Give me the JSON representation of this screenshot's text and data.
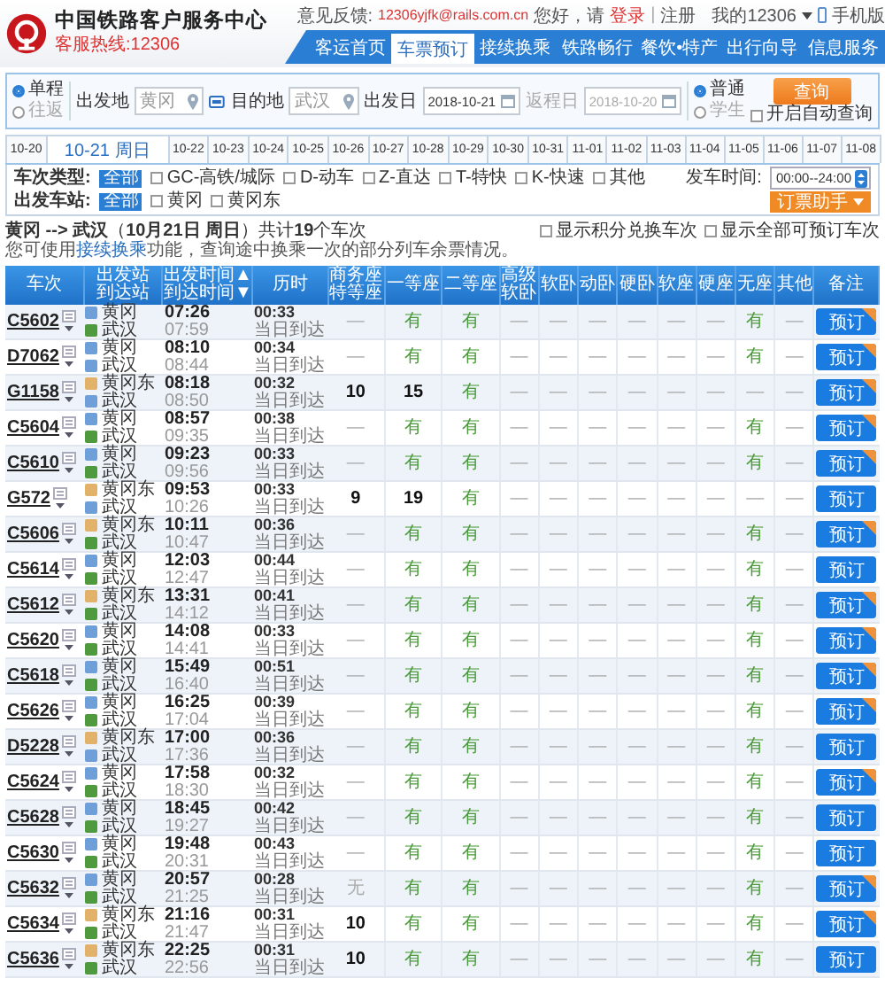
{
  "header": {
    "title": "中国铁路客户服务中心",
    "hotline": "客服热线:12306",
    "feedback_label": "意见反馈:",
    "feedback_email": "12306yjfk@rails.com.cn",
    "greeting": "您好，请",
    "login": "登录",
    "separator": "|",
    "register": "注册",
    "my_account": "我的12306",
    "mobile": "手机版"
  },
  "nav": [
    {
      "label": "客运首页",
      "selected": false
    },
    {
      "label": "车票预订",
      "selected": true
    },
    {
      "label": "接续换乘",
      "selected": false
    },
    {
      "label": "铁路畅行",
      "selected": false
    },
    {
      "label": "餐饮•特产",
      "selected": false
    },
    {
      "label": "出行向导",
      "selected": false
    },
    {
      "label": "信息服务",
      "selected": false
    }
  ],
  "search": {
    "trip_types": [
      {
        "label": "单程",
        "selected": true
      },
      {
        "label": "往返",
        "selected": false
      }
    ],
    "from": {
      "label": "出发地",
      "placeholder": "黄冈"
    },
    "to": {
      "label": "目的地",
      "placeholder": "武汉"
    },
    "depart": {
      "label": "出发日",
      "value": "2018-10-21",
      "disabled": false
    },
    "return": {
      "label": "返程日",
      "value": "2018-10-20",
      "disabled": true
    },
    "passenger_types": [
      {
        "label": "普通",
        "selected": true
      },
      {
        "label": "学生",
        "selected": false
      }
    ],
    "query_button": "查询",
    "auto_query": {
      "label": "开启自动查询",
      "checked": false
    }
  },
  "date_tabs": [
    {
      "label": "10-20",
      "selected": false
    },
    {
      "label": "10-21 周日",
      "selected": true
    },
    {
      "label": "10-22",
      "selected": false
    },
    {
      "label": "10-23",
      "selected": false
    },
    {
      "label": "10-24",
      "selected": false
    },
    {
      "label": "10-25",
      "selected": false
    },
    {
      "label": "10-26",
      "selected": false
    },
    {
      "label": "10-27",
      "selected": false
    },
    {
      "label": "10-28",
      "selected": false
    },
    {
      "label": "10-29",
      "selected": false
    },
    {
      "label": "10-30",
      "selected": false
    },
    {
      "label": "10-31",
      "selected": false
    },
    {
      "label": "11-01",
      "selected": false
    },
    {
      "label": "11-02",
      "selected": false
    },
    {
      "label": "11-03",
      "selected": false
    },
    {
      "label": "11-04",
      "selected": false
    },
    {
      "label": "11-05",
      "selected": false
    },
    {
      "label": "11-06",
      "selected": false
    },
    {
      "label": "11-07",
      "selected": false
    },
    {
      "label": "11-08",
      "selected": false
    }
  ],
  "filters": {
    "type_label": "车次类型:",
    "type_all": "全部",
    "types": [
      {
        "label": "GC-高铁/城际",
        "checked": false
      },
      {
        "label": "D-动车",
        "checked": false
      },
      {
        "label": "Z-直达",
        "checked": false
      },
      {
        "label": "T-特快",
        "checked": false
      },
      {
        "label": "K-快速",
        "checked": false
      },
      {
        "label": "其他",
        "checked": false
      }
    ],
    "time_label": "发车时间:",
    "time_value": "00:00--24:00",
    "station_label": "出发车站:",
    "station_all": "全部",
    "stations": [
      {
        "label": "黄冈",
        "checked": false
      },
      {
        "label": "黄冈东",
        "checked": false
      }
    ],
    "helper_button": "订票助手"
  },
  "summary": {
    "text": "**黄冈 --> 武汉**（**10月21日  周日**）共计**19**个车次",
    "options": [
      {
        "label": "显示积分兑换车次",
        "checked": false
      },
      {
        "label": "显示全部可预订车次",
        "checked": false
      }
    ],
    "hint_before": "您可使用",
    "hint_link": "接续换乘",
    "hint_after": "功能，查询途中换乘一次的部分列车余票情况。"
  },
  "table": {
    "columns": [
      {
        "lines": [
          "车次"
        ]
      },
      {
        "lines": [
          "出发站",
          "到达站"
        ]
      },
      {
        "lines": [
          "出发时间▲",
          "到达时间▼"
        ]
      },
      {
        "lines": [
          "历时"
        ]
      },
      {
        "lines": [
          "商务座",
          "特等座"
        ]
      },
      {
        "lines": [
          "一等座"
        ]
      },
      {
        "lines": [
          "二等座"
        ]
      },
      {
        "lines": [
          "高级",
          "软卧"
        ]
      },
      {
        "lines": [
          "软卧"
        ]
      },
      {
        "lines": [
          "动卧"
        ]
      },
      {
        "lines": [
          "硬卧"
        ]
      },
      {
        "lines": [
          "软座"
        ]
      },
      {
        "lines": [
          "硬座"
        ]
      },
      {
        "lines": [
          "无座"
        ]
      },
      {
        "lines": [
          "其他"
        ]
      },
      {
        "lines": [
          "备注"
        ]
      }
    ],
    "rows": [
      {
        "train": "C5602",
        "from": {
          "name": "黄冈",
          "color": "#6f9fd8"
        },
        "to": {
          "name": "武汉",
          "color": "#4f9a3f"
        },
        "depart": "07:26",
        "arrive": "07:59",
        "duration": "00:33",
        "arrival_day": "当日到达",
        "seats": [
          {
            "text": "—",
            "kind": "none"
          },
          {
            "text": "有",
            "kind": "available"
          },
          {
            "text": "有",
            "kind": "available"
          },
          {
            "text": "—",
            "kind": "none"
          },
          {
            "text": "—",
            "kind": "none"
          },
          {
            "text": "—",
            "kind": "none"
          },
          {
            "text": "—",
            "kind": "none"
          },
          {
            "text": "—",
            "kind": "none"
          },
          {
            "text": "—",
            "kind": "none"
          },
          {
            "text": "有",
            "kind": "available"
          },
          {
            "text": "—",
            "kind": "none"
          }
        ],
        "button": "预订",
        "promo": true
      },
      {
        "train": "D7062",
        "from": {
          "name": "黄冈",
          "color": "#6f9fd8"
        },
        "to": {
          "name": "武汉",
          "color": "#6f9fd8"
        },
        "depart": "08:10",
        "arrive": "08:44",
        "duration": "00:34",
        "arrival_day": "当日到达",
        "seats": [
          {
            "text": "—",
            "kind": "none"
          },
          {
            "text": "有",
            "kind": "available"
          },
          {
            "text": "有",
            "kind": "available"
          },
          {
            "text": "—",
            "kind": "none"
          },
          {
            "text": "—",
            "kind": "none"
          },
          {
            "text": "—",
            "kind": "none"
          },
          {
            "text": "—",
            "kind": "none"
          },
          {
            "text": "—",
            "kind": "none"
          },
          {
            "text": "—",
            "kind": "none"
          },
          {
            "text": "有",
            "kind": "available"
          },
          {
            "text": "—",
            "kind": "none"
          }
        ],
        "button": "预订",
        "promo": true
      },
      {
        "train": "G1158",
        "from": {
          "name": "黄冈东",
          "color": "#e3b26a"
        },
        "to": {
          "name": "武汉",
          "color": "#6f9fd8"
        },
        "depart": "08:18",
        "arrive": "08:50",
        "duration": "00:32",
        "arrival_day": "当日到达",
        "seats": [
          {
            "text": "10",
            "kind": "count"
          },
          {
            "text": "15",
            "kind": "count"
          },
          {
            "text": "有",
            "kind": "available"
          },
          {
            "text": "—",
            "kind": "none"
          },
          {
            "text": "—",
            "kind": "none"
          },
          {
            "text": "—",
            "kind": "none"
          },
          {
            "text": "—",
            "kind": "none"
          },
          {
            "text": "—",
            "kind": "none"
          },
          {
            "text": "—",
            "kind": "none"
          },
          {
            "text": "—",
            "kind": "none"
          },
          {
            "text": "—",
            "kind": "none"
          }
        ],
        "button": "预订",
        "promo": true
      },
      {
        "train": "C5604",
        "from": {
          "name": "黄冈",
          "color": "#6f9fd8"
        },
        "to": {
          "name": "武汉",
          "color": "#4f9a3f"
        },
        "depart": "08:57",
        "arrive": "09:35",
        "duration": "00:38",
        "arrival_day": "当日到达",
        "seats": [
          {
            "text": "—",
            "kind": "none"
          },
          {
            "text": "有",
            "kind": "available"
          },
          {
            "text": "有",
            "kind": "available"
          },
          {
            "text": "—",
            "kind": "none"
          },
          {
            "text": "—",
            "kind": "none"
          },
          {
            "text": "—",
            "kind": "none"
          },
          {
            "text": "—",
            "kind": "none"
          },
          {
            "text": "—",
            "kind": "none"
          },
          {
            "text": "—",
            "kind": "none"
          },
          {
            "text": "有",
            "kind": "available"
          },
          {
            "text": "—",
            "kind": "none"
          }
        ],
        "button": "预订",
        "promo": true
      },
      {
        "train": "C5610",
        "from": {
          "name": "黄冈",
          "color": "#6f9fd8"
        },
        "to": {
          "name": "武汉",
          "color": "#4f9a3f"
        },
        "depart": "09:23",
        "arrive": "09:56",
        "duration": "00:33",
        "arrival_day": "当日到达",
        "seats": [
          {
            "text": "—",
            "kind": "none"
          },
          {
            "text": "有",
            "kind": "available"
          },
          {
            "text": "有",
            "kind": "available"
          },
          {
            "text": "—",
            "kind": "none"
          },
          {
            "text": "—",
            "kind": "none"
          },
          {
            "text": "—",
            "kind": "none"
          },
          {
            "text": "—",
            "kind": "none"
          },
          {
            "text": "—",
            "kind": "none"
          },
          {
            "text": "—",
            "kind": "none"
          },
          {
            "text": "有",
            "kind": "available"
          },
          {
            "text": "—",
            "kind": "none"
          }
        ],
        "button": "预订",
        "promo": true
      },
      {
        "train": "G572",
        "from": {
          "name": "黄冈东",
          "color": "#e3b26a"
        },
        "to": {
          "name": "武汉",
          "color": "#6f9fd8"
        },
        "depart": "09:53",
        "arrive": "10:26",
        "duration": "00:33",
        "arrival_day": "当日到达",
        "seats": [
          {
            "text": "9",
            "kind": "count"
          },
          {
            "text": "19",
            "kind": "count"
          },
          {
            "text": "有",
            "kind": "available"
          },
          {
            "text": "—",
            "kind": "none"
          },
          {
            "text": "—",
            "kind": "none"
          },
          {
            "text": "—",
            "kind": "none"
          },
          {
            "text": "—",
            "kind": "none"
          },
          {
            "text": "—",
            "kind": "none"
          },
          {
            "text": "—",
            "kind": "none"
          },
          {
            "text": "—",
            "kind": "none"
          },
          {
            "text": "—",
            "kind": "none"
          }
        ],
        "button": "预订",
        "promo": false
      },
      {
        "train": "C5606",
        "from": {
          "name": "黄冈东",
          "color": "#e3b26a"
        },
        "to": {
          "name": "武汉",
          "color": "#4f9a3f"
        },
        "depart": "10:11",
        "arrive": "10:47",
        "duration": "00:36",
        "arrival_day": "当日到达",
        "seats": [
          {
            "text": "—",
            "kind": "none"
          },
          {
            "text": "有",
            "kind": "available"
          },
          {
            "text": "有",
            "kind": "available"
          },
          {
            "text": "—",
            "kind": "none"
          },
          {
            "text": "—",
            "kind": "none"
          },
          {
            "text": "—",
            "kind": "none"
          },
          {
            "text": "—",
            "kind": "none"
          },
          {
            "text": "—",
            "kind": "none"
          },
          {
            "text": "—",
            "kind": "none"
          },
          {
            "text": "有",
            "kind": "available"
          },
          {
            "text": "—",
            "kind": "none"
          }
        ],
        "button": "预订",
        "promo": true
      },
      {
        "train": "C5614",
        "from": {
          "name": "黄冈",
          "color": "#6f9fd8"
        },
        "to": {
          "name": "武汉",
          "color": "#4f9a3f"
        },
        "depart": "12:03",
        "arrive": "12:47",
        "duration": "00:44",
        "arrival_day": "当日到达",
        "seats": [
          {
            "text": "—",
            "kind": "none"
          },
          {
            "text": "有",
            "kind": "available"
          },
          {
            "text": "有",
            "kind": "available"
          },
          {
            "text": "—",
            "kind": "none"
          },
          {
            "text": "—",
            "kind": "none"
          },
          {
            "text": "—",
            "kind": "none"
          },
          {
            "text": "—",
            "kind": "none"
          },
          {
            "text": "—",
            "kind": "none"
          },
          {
            "text": "—",
            "kind": "none"
          },
          {
            "text": "有",
            "kind": "available"
          },
          {
            "text": "—",
            "kind": "none"
          }
        ],
        "button": "预订",
        "promo": false
      },
      {
        "train": "C5612",
        "from": {
          "name": "黄冈东",
          "color": "#e3b26a"
        },
        "to": {
          "name": "武汉",
          "color": "#4f9a3f"
        },
        "depart": "13:31",
        "arrive": "14:12",
        "duration": "00:41",
        "arrival_day": "当日到达",
        "seats": [
          {
            "text": "—",
            "kind": "none"
          },
          {
            "text": "有",
            "kind": "available"
          },
          {
            "text": "有",
            "kind": "available"
          },
          {
            "text": "—",
            "kind": "none"
          },
          {
            "text": "—",
            "kind": "none"
          },
          {
            "text": "—",
            "kind": "none"
          },
          {
            "text": "—",
            "kind": "none"
          },
          {
            "text": "—",
            "kind": "none"
          },
          {
            "text": "—",
            "kind": "none"
          },
          {
            "text": "有",
            "kind": "available"
          },
          {
            "text": "—",
            "kind": "none"
          }
        ],
        "button": "预订",
        "promo": true
      },
      {
        "train": "C5620",
        "from": {
          "name": "黄冈",
          "color": "#6f9fd8"
        },
        "to": {
          "name": "武汉",
          "color": "#4f9a3f"
        },
        "depart": "14:08",
        "arrive": "14:41",
        "duration": "00:33",
        "arrival_day": "当日到达",
        "seats": [
          {
            "text": "—",
            "kind": "none"
          },
          {
            "text": "有",
            "kind": "available"
          },
          {
            "text": "有",
            "kind": "available"
          },
          {
            "text": "—",
            "kind": "none"
          },
          {
            "text": "—",
            "kind": "none"
          },
          {
            "text": "—",
            "kind": "none"
          },
          {
            "text": "—",
            "kind": "none"
          },
          {
            "text": "—",
            "kind": "none"
          },
          {
            "text": "—",
            "kind": "none"
          },
          {
            "text": "有",
            "kind": "available"
          },
          {
            "text": "—",
            "kind": "none"
          }
        ],
        "button": "预订",
        "promo": true
      },
      {
        "train": "C5618",
        "from": {
          "name": "黄冈",
          "color": "#6f9fd8"
        },
        "to": {
          "name": "武汉",
          "color": "#4f9a3f"
        },
        "depart": "15:49",
        "arrive": "16:40",
        "duration": "00:51",
        "arrival_day": "当日到达",
        "seats": [
          {
            "text": "—",
            "kind": "none"
          },
          {
            "text": "有",
            "kind": "available"
          },
          {
            "text": "有",
            "kind": "available"
          },
          {
            "text": "—",
            "kind": "none"
          },
          {
            "text": "—",
            "kind": "none"
          },
          {
            "text": "—",
            "kind": "none"
          },
          {
            "text": "—",
            "kind": "none"
          },
          {
            "text": "—",
            "kind": "none"
          },
          {
            "text": "—",
            "kind": "none"
          },
          {
            "text": "有",
            "kind": "available"
          },
          {
            "text": "—",
            "kind": "none"
          }
        ],
        "button": "预订",
        "promo": true
      },
      {
        "train": "C5626",
        "from": {
          "name": "黄冈",
          "color": "#6f9fd8"
        },
        "to": {
          "name": "武汉",
          "color": "#4f9a3f"
        },
        "depart": "16:25",
        "arrive": "17:04",
        "duration": "00:39",
        "arrival_day": "当日到达",
        "seats": [
          {
            "text": "—",
            "kind": "none"
          },
          {
            "text": "有",
            "kind": "available"
          },
          {
            "text": "有",
            "kind": "available"
          },
          {
            "text": "—",
            "kind": "none"
          },
          {
            "text": "—",
            "kind": "none"
          },
          {
            "text": "—",
            "kind": "none"
          },
          {
            "text": "—",
            "kind": "none"
          },
          {
            "text": "—",
            "kind": "none"
          },
          {
            "text": "—",
            "kind": "none"
          },
          {
            "text": "有",
            "kind": "available"
          },
          {
            "text": "—",
            "kind": "none"
          }
        ],
        "button": "预订",
        "promo": true
      },
      {
        "train": "D5228",
        "from": {
          "name": "黄冈东",
          "color": "#e3b26a"
        },
        "to": {
          "name": "武汉",
          "color": "#6f9fd8"
        },
        "depart": "17:00",
        "arrive": "17:36",
        "duration": "00:36",
        "arrival_day": "当日到达",
        "seats": [
          {
            "text": "—",
            "kind": "none"
          },
          {
            "text": "有",
            "kind": "available"
          },
          {
            "text": "有",
            "kind": "available"
          },
          {
            "text": "—",
            "kind": "none"
          },
          {
            "text": "—",
            "kind": "none"
          },
          {
            "text": "—",
            "kind": "none"
          },
          {
            "text": "—",
            "kind": "none"
          },
          {
            "text": "—",
            "kind": "none"
          },
          {
            "text": "—",
            "kind": "none"
          },
          {
            "text": "有",
            "kind": "available"
          },
          {
            "text": "—",
            "kind": "none"
          }
        ],
        "button": "预订",
        "promo": false
      },
      {
        "train": "C5624",
        "from": {
          "name": "黄冈",
          "color": "#6f9fd8"
        },
        "to": {
          "name": "武汉",
          "color": "#4f9a3f"
        },
        "depart": "17:58",
        "arrive": "18:30",
        "duration": "00:32",
        "arrival_day": "当日到达",
        "seats": [
          {
            "text": "—",
            "kind": "none"
          },
          {
            "text": "有",
            "kind": "available"
          },
          {
            "text": "有",
            "kind": "available"
          },
          {
            "text": "—",
            "kind": "none"
          },
          {
            "text": "—",
            "kind": "none"
          },
          {
            "text": "—",
            "kind": "none"
          },
          {
            "text": "—",
            "kind": "none"
          },
          {
            "text": "—",
            "kind": "none"
          },
          {
            "text": "—",
            "kind": "none"
          },
          {
            "text": "有",
            "kind": "available"
          },
          {
            "text": "—",
            "kind": "none"
          }
        ],
        "button": "预订",
        "promo": true
      },
      {
        "train": "C5628",
        "from": {
          "name": "黄冈",
          "color": "#6f9fd8"
        },
        "to": {
          "name": "武汉",
          "color": "#4f9a3f"
        },
        "depart": "18:45",
        "arrive": "19:27",
        "duration": "00:42",
        "arrival_day": "当日到达",
        "seats": [
          {
            "text": "—",
            "kind": "none"
          },
          {
            "text": "有",
            "kind": "available"
          },
          {
            "text": "有",
            "kind": "available"
          },
          {
            "text": "—",
            "kind": "none"
          },
          {
            "text": "—",
            "kind": "none"
          },
          {
            "text": "—",
            "kind": "none"
          },
          {
            "text": "—",
            "kind": "none"
          },
          {
            "text": "—",
            "kind": "none"
          },
          {
            "text": "—",
            "kind": "none"
          },
          {
            "text": "有",
            "kind": "available"
          },
          {
            "text": "—",
            "kind": "none"
          }
        ],
        "button": "预订",
        "promo": false
      },
      {
        "train": "C5630",
        "from": {
          "name": "黄冈",
          "color": "#6f9fd8"
        },
        "to": {
          "name": "武汉",
          "color": "#4f9a3f"
        },
        "depart": "19:48",
        "arrive": "20:31",
        "duration": "00:43",
        "arrival_day": "当日到达",
        "seats": [
          {
            "text": "—",
            "kind": "none"
          },
          {
            "text": "有",
            "kind": "available"
          },
          {
            "text": "有",
            "kind": "available"
          },
          {
            "text": "—",
            "kind": "none"
          },
          {
            "text": "—",
            "kind": "none"
          },
          {
            "text": "—",
            "kind": "none"
          },
          {
            "text": "—",
            "kind": "none"
          },
          {
            "text": "—",
            "kind": "none"
          },
          {
            "text": "—",
            "kind": "none"
          },
          {
            "text": "有",
            "kind": "available"
          },
          {
            "text": "—",
            "kind": "none"
          }
        ],
        "button": "预订",
        "promo": false
      },
      {
        "train": "C5632",
        "from": {
          "name": "黄冈",
          "color": "#6f9fd8"
        },
        "to": {
          "name": "武汉",
          "color": "#4f9a3f"
        },
        "depart": "20:57",
        "arrive": "21:25",
        "duration": "00:28",
        "arrival_day": "当日到达",
        "seats": [
          {
            "text": "无",
            "kind": "soldout"
          },
          {
            "text": "有",
            "kind": "available"
          },
          {
            "text": "有",
            "kind": "available"
          },
          {
            "text": "—",
            "kind": "none"
          },
          {
            "text": "—",
            "kind": "none"
          },
          {
            "text": "—",
            "kind": "none"
          },
          {
            "text": "—",
            "kind": "none"
          },
          {
            "text": "—",
            "kind": "none"
          },
          {
            "text": "—",
            "kind": "none"
          },
          {
            "text": "有",
            "kind": "available"
          },
          {
            "text": "—",
            "kind": "none"
          }
        ],
        "button": "预订",
        "promo": true
      },
      {
        "train": "C5634",
        "from": {
          "name": "黄冈东",
          "color": "#e3b26a"
        },
        "to": {
          "name": "武汉",
          "color": "#4f9a3f"
        },
        "depart": "21:16",
        "arrive": "21:47",
        "duration": "00:31",
        "arrival_day": "当日到达",
        "seats": [
          {
            "text": "10",
            "kind": "count"
          },
          {
            "text": "有",
            "kind": "available"
          },
          {
            "text": "有",
            "kind": "available"
          },
          {
            "text": "—",
            "kind": "none"
          },
          {
            "text": "—",
            "kind": "none"
          },
          {
            "text": "—",
            "kind": "none"
          },
          {
            "text": "—",
            "kind": "none"
          },
          {
            "text": "—",
            "kind": "none"
          },
          {
            "text": "—",
            "kind": "none"
          },
          {
            "text": "有",
            "kind": "available"
          },
          {
            "text": "—",
            "kind": "none"
          }
        ],
        "button": "预订",
        "promo": true
      },
      {
        "train": "C5636",
        "from": {
          "name": "黄冈东",
          "color": "#e3b26a"
        },
        "to": {
          "name": "武汉",
          "color": "#4f9a3f"
        },
        "depart": "22:25",
        "arrive": "22:56",
        "duration": "00:31",
        "arrival_day": "当日到达",
        "seats": [
          {
            "text": "10",
            "kind": "count"
          },
          {
            "text": "有",
            "kind": "available"
          },
          {
            "text": "有",
            "kind": "available"
          },
          {
            "text": "—",
            "kind": "none"
          },
          {
            "text": "—",
            "kind": "none"
          },
          {
            "text": "—",
            "kind": "none"
          },
          {
            "text": "—",
            "kind": "none"
          },
          {
            "text": "—",
            "kind": "none"
          },
          {
            "text": "—",
            "kind": "none"
          },
          {
            "text": "有",
            "kind": "available"
          },
          {
            "text": "—",
            "kind": "none"
          }
        ],
        "button": "预订",
        "promo": false
      }
    ]
  }
}
